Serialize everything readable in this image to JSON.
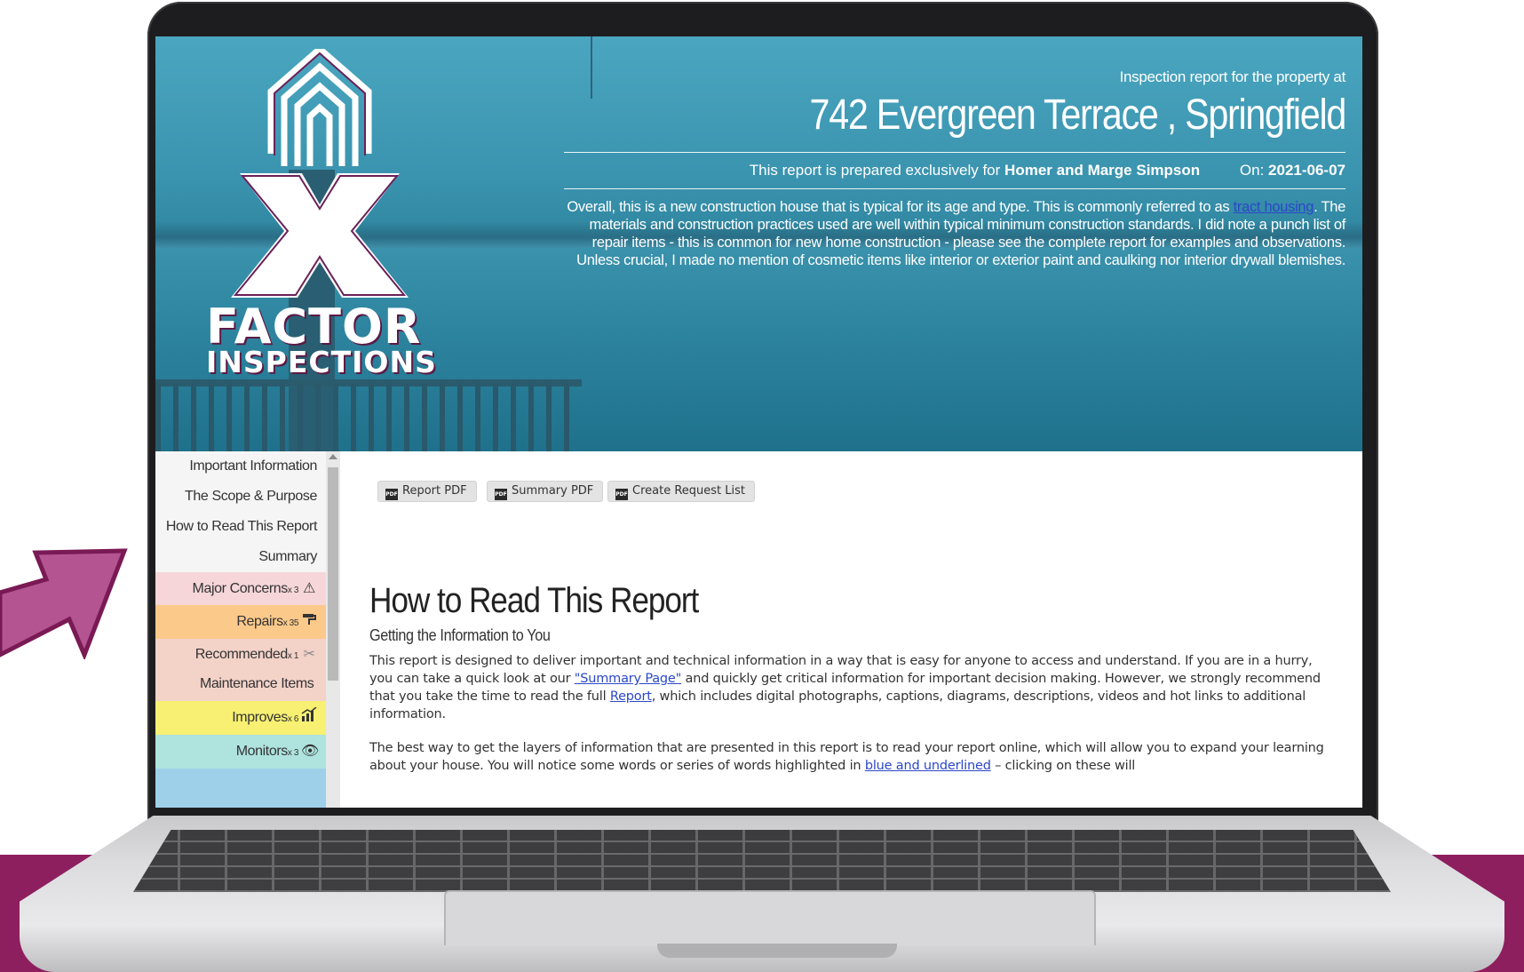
{
  "colors": {
    "brand_magenta": "#8e1f5f",
    "hero_teal": "#2f88a3",
    "link_blue": "#2b48c8"
  },
  "logo": {
    "line1": "FACTOR",
    "line2": "INSPECTIONS",
    "mark": "X"
  },
  "header": {
    "subtitle": "Inspection report for the property at",
    "address": "742 Evergreen Terrace , Springfield",
    "prepared_prefix": "This report is prepared exclusively for",
    "client": "Homer and Marge Simpson",
    "on_label": "On:",
    "date": "2021-06-07",
    "desc_before": "Overall, this is a new construction house that is typical for its age and type. This is commonly referred to as",
    "desc_link": "tract housing",
    "desc_after": ". The materials and construction practices used are well within typical minimum construction standards. I did note a punch list of repair items - this is common for new home construction - please see the complete report for examples and observations. Unless crucial, I made no mention of cosmetic items like interior or exterior paint and caulking nor interior drywall blemishes."
  },
  "sidebar": {
    "items": [
      {
        "label": "Important Information"
      },
      {
        "label": "The Scope & Purpose"
      },
      {
        "label": "How to Read This Report"
      },
      {
        "label": "Summary"
      },
      {
        "label": "Major Concerns",
        "count": "x 3",
        "icon": "warning-icon",
        "color": "#f6d6d9"
      },
      {
        "label": "Repairs",
        "count": "x 35",
        "icon": "paint-roller-icon",
        "color": "#fbc98a"
      },
      {
        "label": "Recommended",
        "count": "x 1",
        "icon": "tools-icon",
        "color": "#f3d2c8"
      },
      {
        "label": "Maintenance Items",
        "color": "#f3d2c8"
      },
      {
        "label": "Improves",
        "count": "x 6",
        "icon": "chart-icon",
        "color": "#f7f072"
      },
      {
        "label": "Monitors",
        "count": "x 3",
        "icon": "eye-icon",
        "color": "#aee3de"
      }
    ]
  },
  "toolbar": {
    "report_pdf": "Report PDF",
    "summary_pdf": "Summary PDF",
    "request_list": "Create Request List",
    "pdf_icon": "PDF"
  },
  "content": {
    "title": "How to Read This Report",
    "subtitle": "Getting the Information to You",
    "p1_a": "This report is designed to deliver important and technical information in a way that is easy for anyone to access and understand. If you are in a hurry, you can take a quick look at our ",
    "p1_link1": "\"Summary Page\"",
    "p1_b": " and quickly get critical information for important decision making. However, we strongly recommend that you take the time to read the full ",
    "p1_link2": "Report",
    "p1_c": ", which includes digital photographs, captions, diagrams, descriptions, videos and hot links to additional information.",
    "p2_a": "The best way to get the layers of information that are presented in this report is to read your report online, which will allow you to expand your learning about your house. You will notice some words or series of words highlighted in ",
    "p2_link": "blue and underlined",
    "p2_b": " – clicking on these will"
  }
}
